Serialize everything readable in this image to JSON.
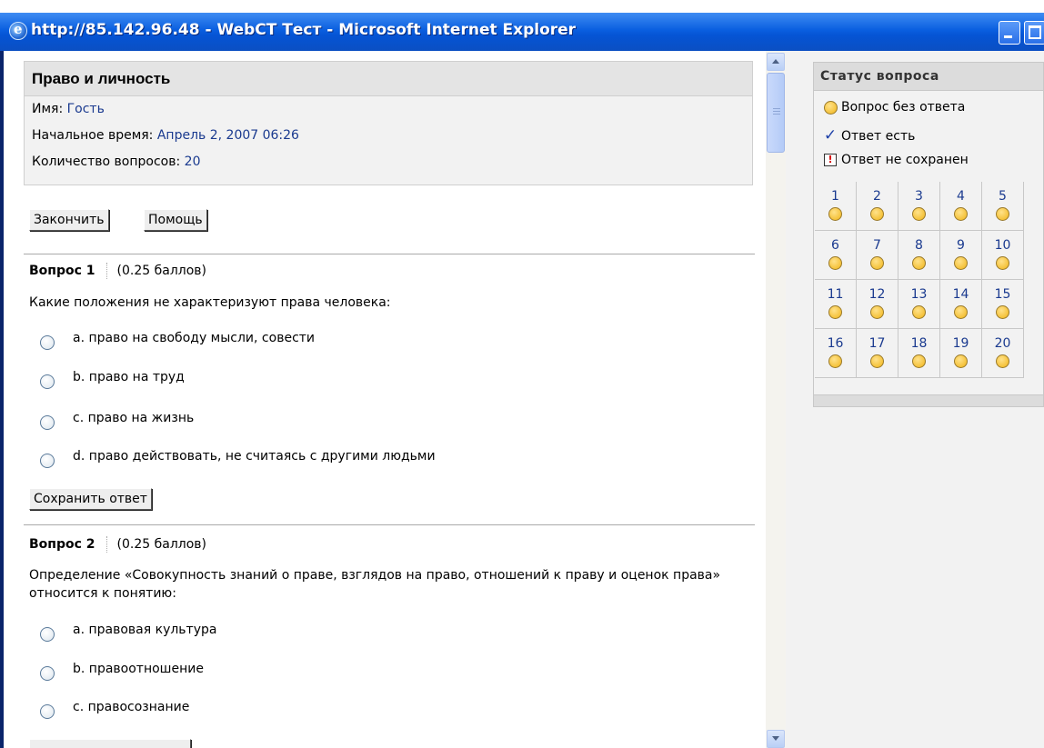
{
  "window": {
    "title": "http://85.142.96.48 - WebCT Тест - Microsoft Internet Explorer"
  },
  "quiz": {
    "title": "Право и личность",
    "name_label": "Имя: ",
    "name_value": "Гость",
    "start_label": "Начальное время: ",
    "start_value": "Апрель 2, 2007 06:26",
    "count_label": "Количество вопросов: ",
    "count_value": "20",
    "finish_button": "Закончить",
    "help_button": "Помощь"
  },
  "questions": [
    {
      "label": "Вопрос 1",
      "points": "(0.25 баллов)",
      "text": "Какие положения не характеризуют права человека:",
      "options": [
        "a. право на свободу мысли, совести",
        "b. право на труд",
        "c. право на жизнь",
        "d. право действовать, не считаясь с другими людьми"
      ],
      "save_button": "Сохранить ответ"
    },
    {
      "label": "Вопрос 2",
      "points": "(0.25 баллов)",
      "text": "Определение «Совокупность знаний о праве, взглядов на право, отношений к праву и оценок права» относится к понятию:",
      "options": [
        "a. правовая культура",
        "b. правоотношение",
        "c. правосознание"
      ]
    }
  ],
  "status_panel": {
    "title": "Статус вопроса",
    "legend": [
      {
        "icon": "unanswered-circle-icon",
        "text": "Вопрос без ответа"
      },
      {
        "icon": "checkmark-icon",
        "text": "Ответ есть"
      },
      {
        "icon": "warning-icon",
        "text": "Ответ не сохранен"
      }
    ],
    "questions": [
      "1",
      "2",
      "3",
      "4",
      "5",
      "6",
      "7",
      "8",
      "9",
      "10",
      "11",
      "12",
      "13",
      "14",
      "15",
      "16",
      "17",
      "18",
      "19",
      "20"
    ],
    "colors": {
      "unanswered": "#f0b418",
      "check": "#1c3fa8",
      "warning": "#d60000"
    }
  }
}
